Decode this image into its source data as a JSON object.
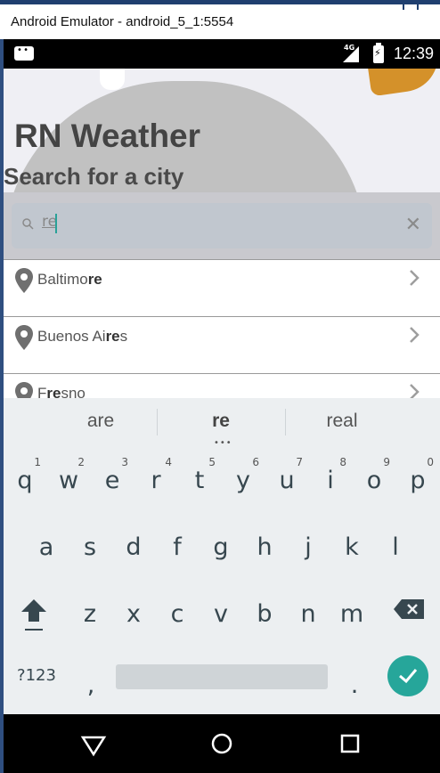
{
  "window": {
    "title": "Android Emulator - android_5_1:5554"
  },
  "status_bar": {
    "network": "4G",
    "time": "12:39"
  },
  "app": {
    "title": "RN Weather",
    "subtitle": "Search for a city",
    "search": {
      "value": "re"
    },
    "results": [
      {
        "pre": "Baltimo",
        "match": "re",
        "post": ""
      },
      {
        "pre": "Buenos Ai",
        "match": "re",
        "post": "s"
      },
      {
        "pre": "F",
        "match": "re",
        "post": "sno"
      }
    ]
  },
  "keyboard": {
    "suggestions": [
      "are",
      "re",
      "real"
    ],
    "row1": [
      {
        "k": "q",
        "h": "1"
      },
      {
        "k": "w",
        "h": "2"
      },
      {
        "k": "e",
        "h": "3"
      },
      {
        "k": "r",
        "h": "4"
      },
      {
        "k": "t",
        "h": "5"
      },
      {
        "k": "y",
        "h": "6"
      },
      {
        "k": "u",
        "h": "7"
      },
      {
        "k": "i",
        "h": "8"
      },
      {
        "k": "o",
        "h": "9"
      },
      {
        "k": "p",
        "h": "0"
      }
    ],
    "row2": [
      "a",
      "s",
      "d",
      "f",
      "g",
      "h",
      "j",
      "k",
      "l"
    ],
    "row3": [
      "z",
      "x",
      "c",
      "v",
      "b",
      "n",
      "m"
    ],
    "symbols_label": "?123",
    "comma_label": ",",
    "period_label": "."
  },
  "colors": {
    "accent": "#26a69a",
    "sun": "#d4912a",
    "cloud": "#c1c1c1"
  }
}
